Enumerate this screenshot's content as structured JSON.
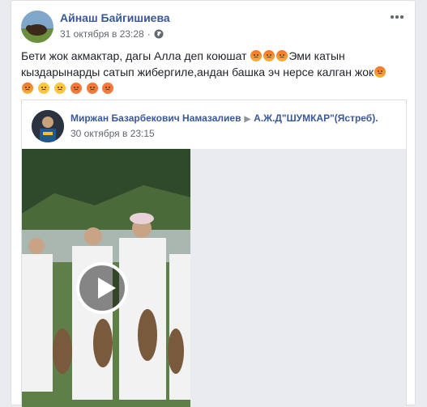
{
  "post": {
    "author": "Айнаш Байгишиева",
    "date": "31 октября в 23:28",
    "separator": "·",
    "privacy_icon": "globe-icon",
    "line1_a": "Бети жок акмактар, дагы Алла деп коюшат ",
    "line1_b": "Эми катын",
    "line2_a": "кыздарынарды сатып жибергиле,андан башка эч нерсе калган жок",
    "emojis_line1": [
      "angry",
      "angry",
      "angry"
    ],
    "emojis_line2_end": [
      "angry"
    ],
    "emojis_line3": [
      "angry",
      "steam",
      "sad",
      "shock",
      "shock",
      "shock"
    ]
  },
  "shared": {
    "author": "Миржан Базарбекович Намазалиев",
    "arrow": "▶",
    "target": "А.Ж.Д\"ШУМКАР\"(Ястреб).",
    "date": "30 октября в 23:15"
  },
  "icons": {
    "more": "more-dots-icon",
    "play": "play-icon"
  }
}
